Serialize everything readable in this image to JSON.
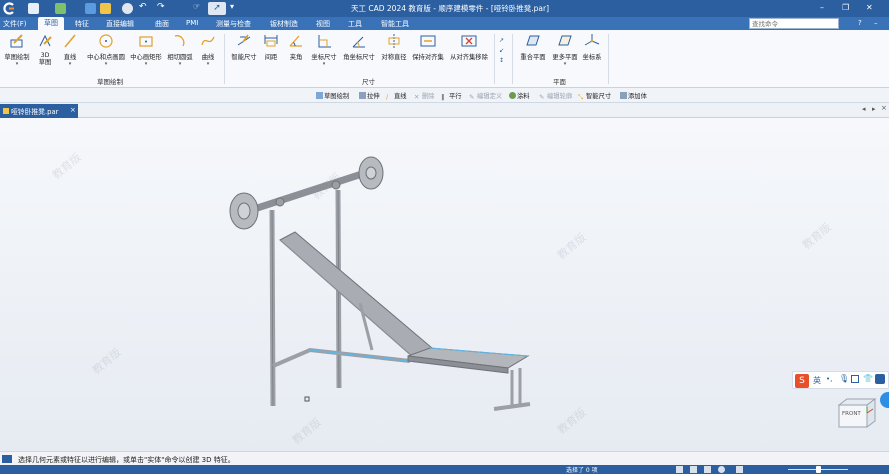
{
  "title": "天工 CAD 2024 教育版 - 顺序建模零件 - [哑铃卧推凳.par]",
  "window_controls": {
    "help": "?",
    "minimize": "–",
    "restore": "❐",
    "close": "✕"
  },
  "menu": [
    "文件(F)",
    "草图",
    "特征",
    "直接编辑",
    "曲面",
    "PMI",
    "测量与检查",
    "钣材制造",
    "视图",
    "工具",
    "智能工具"
  ],
  "active_menu_index": 1,
  "search": {
    "placeholder": "查找命令"
  },
  "ribbon": {
    "sketch_group": {
      "buttons": [
        "草图绘制",
        "3D\n草图",
        "直线",
        "中心和点画圆",
        "中心画矩形",
        "相切圆弧",
        "曲线"
      ],
      "label": "草图绘制"
    },
    "dim_group": {
      "buttons": [
        "智能尺寸",
        "间距",
        "夹角",
        "坐标尺寸",
        "角坐标尺寸",
        "对称直径",
        "保持对齐集",
        "从对齐集移除"
      ],
      "label": "尺寸"
    },
    "plane_group": {
      "buttons": [
        "重合平面",
        "更多平面",
        "坐标系"
      ],
      "label": "平面"
    }
  },
  "cmdbar": [
    {
      "label": "草图绘制",
      "enabled": true
    },
    {
      "label": "拉伸",
      "enabled": true
    },
    {
      "label": "直线",
      "enabled": true
    },
    {
      "label": "删除",
      "enabled": false
    },
    {
      "label": "平行",
      "enabled": true
    },
    {
      "label": "编辑定义",
      "enabled": false
    },
    {
      "label": "涂料",
      "enabled": true
    },
    {
      "label": "编辑轮廓",
      "enabled": false
    },
    {
      "label": "智能尺寸",
      "enabled": true
    },
    {
      "label": "添加体",
      "enabled": true
    }
  ],
  "doc_tab": "哑铃卧推凳.par",
  "watermark": "教育版",
  "ime": {
    "label": "英"
  },
  "viewcube": {
    "label": "FRONT"
  },
  "status": {
    "prompt": "选择几何元素或特征以进行编辑，或单击\"实体\"命令以创建 3D 特征。",
    "selection": "选择了 0 项"
  },
  "colors": {
    "title_bg": "#2b5fa0",
    "menu_bg": "#3a72b8",
    "accent": "#2b5fa0",
    "model": "#a9adb3",
    "highlight": "#5fb7e6"
  }
}
